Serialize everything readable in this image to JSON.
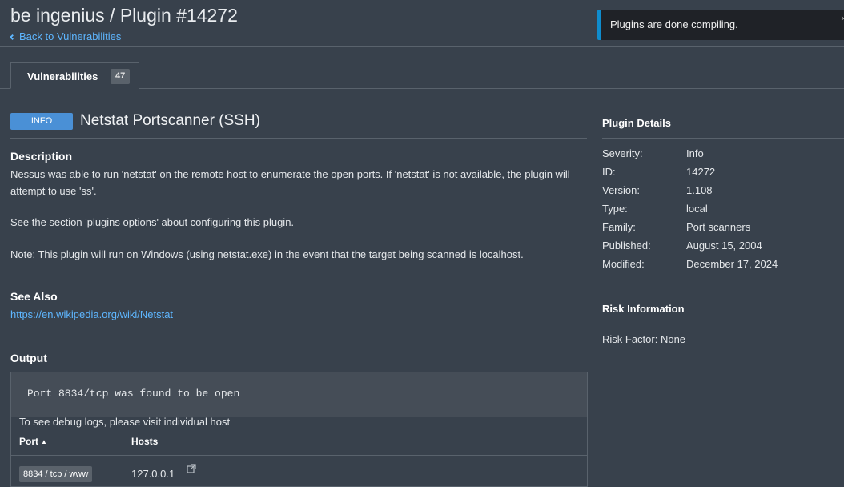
{
  "header": {
    "title": "be ingenius / Plugin #14272",
    "back_link": "Back to Vulnerabilities"
  },
  "toast": {
    "message": "Plugins are done compiling.",
    "close": "×",
    "accent_color": "#0f8ccd"
  },
  "tabs": [
    {
      "label": "Vulnerabilities",
      "count": "47"
    }
  ],
  "plugin": {
    "severity": "INFO",
    "severity_color": "#4a90d6",
    "name": "Netstat Portscanner (SSH)"
  },
  "description": {
    "heading": "Description",
    "paragraphs": [
      "Nessus was able to run 'netstat' on the remote host to enumerate the open ports. If 'netstat' is not available, the plugin will attempt to use 'ss'.",
      "See the section 'plugins options' about configuring this plugin.",
      "Note: This plugin will run on Windows (using netstat.exe) in the event that the target being scanned is localhost."
    ]
  },
  "see_also": {
    "heading": "See Also",
    "link": "https://en.wikipedia.org/wiki/Netstat"
  },
  "output": {
    "heading": "Output",
    "text": "Port 8834/tcp was found to be open",
    "debug_note": "To see debug logs, please visit individual host",
    "columns": {
      "port": "Port",
      "port_sort": "▲",
      "hosts": "Hosts"
    },
    "rows": [
      {
        "port": "8834 / tcp / www",
        "host": "127.0.0.1"
      }
    ]
  },
  "plugin_details": {
    "heading": "Plugin Details",
    "rows": [
      {
        "label": "Severity:",
        "value": "Info"
      },
      {
        "label": "ID:",
        "value": "14272"
      },
      {
        "label": "Version:",
        "value": "1.108"
      },
      {
        "label": "Type:",
        "value": "local"
      },
      {
        "label": "Family:",
        "value": "Port scanners"
      },
      {
        "label": "Published:",
        "value": "August 15, 2004"
      },
      {
        "label": "Modified:",
        "value": "December 17, 2024"
      }
    ]
  },
  "risk_information": {
    "heading": "Risk Information",
    "text": "Risk Factor: None"
  },
  "colors": {
    "background": "#38414c",
    "link": "#5eb6ff",
    "border": "#59626c"
  }
}
